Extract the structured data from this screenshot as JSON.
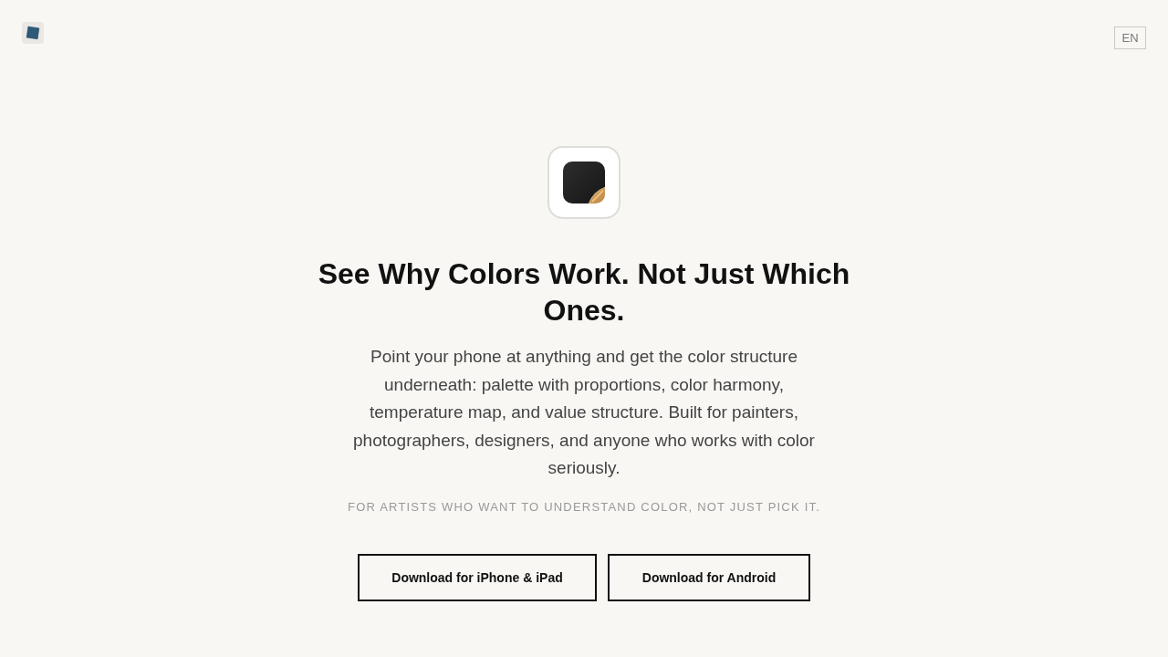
{
  "header": {
    "language": "EN"
  },
  "hero": {
    "title": "See Why Colors Work. Not Just Which Ones.",
    "description": "Point your phone at anything and get the color structure underneath: palette with proportions, color harmony, temperature map, and value structure. Built for painters, photographers, designers, and anyone who works with color seriously.",
    "tagline": "FOR ARTISTS WHO WANT TO UNDERSTAND COLOR, NOT JUST PICK IT.",
    "buttons": [
      "Download for iPhone & iPad",
      "Download for Android"
    ]
  }
}
